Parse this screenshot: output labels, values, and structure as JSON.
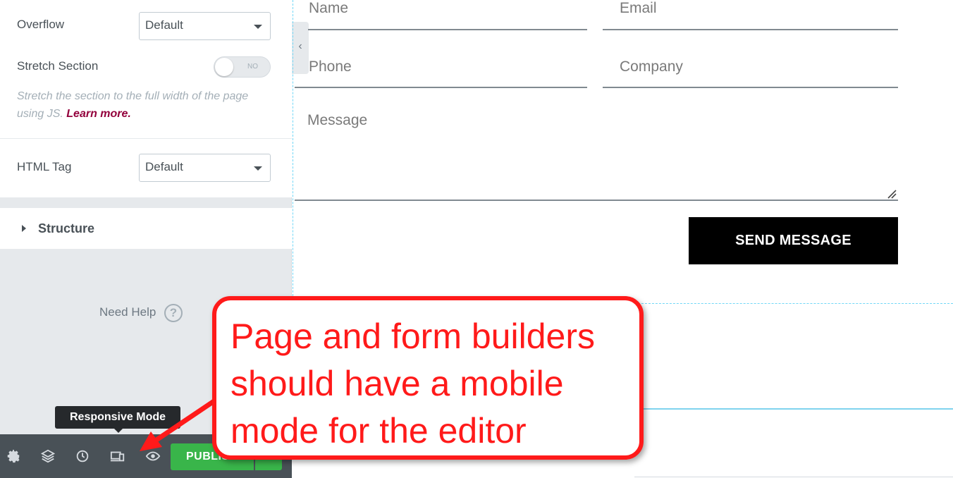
{
  "panel": {
    "overflow_label": "Overflow",
    "overflow_value": "Default",
    "stretch_label": "Stretch Section",
    "stretch_toggle": "NO",
    "stretch_desc": "Stretch the section to the full width of the page using JS.",
    "learn_more": "Learn more.",
    "html_tag_label": "HTML Tag",
    "html_tag_value": "Default",
    "structure_label": "Structure",
    "need_help": "Need Help",
    "help_icon": "?",
    "collapse_icon": "‹"
  },
  "tooltip": {
    "text": "Responsive Mode"
  },
  "footer": {
    "icons": [
      "gear-icon",
      "layers-icon",
      "history-icon",
      "responsive-icon",
      "eye-icon"
    ],
    "publish_label": "PUBLISH"
  },
  "form": {
    "name_placeholder": "Name",
    "email_placeholder": "Email",
    "phone_placeholder": "Phone",
    "company_placeholder": "Company",
    "message_placeholder": "Message",
    "send_label": "SEND MESSAGE"
  },
  "callout": {
    "text": "Page and form builders should have a mobile mode for the editor",
    "color": "#ff1a1a"
  },
  "colors": {
    "publish": "#39b54a",
    "panel_bg": "#e6e9ec",
    "footer_bg": "#495157",
    "link": "#93003c",
    "section_outline": "#71d7f7"
  }
}
